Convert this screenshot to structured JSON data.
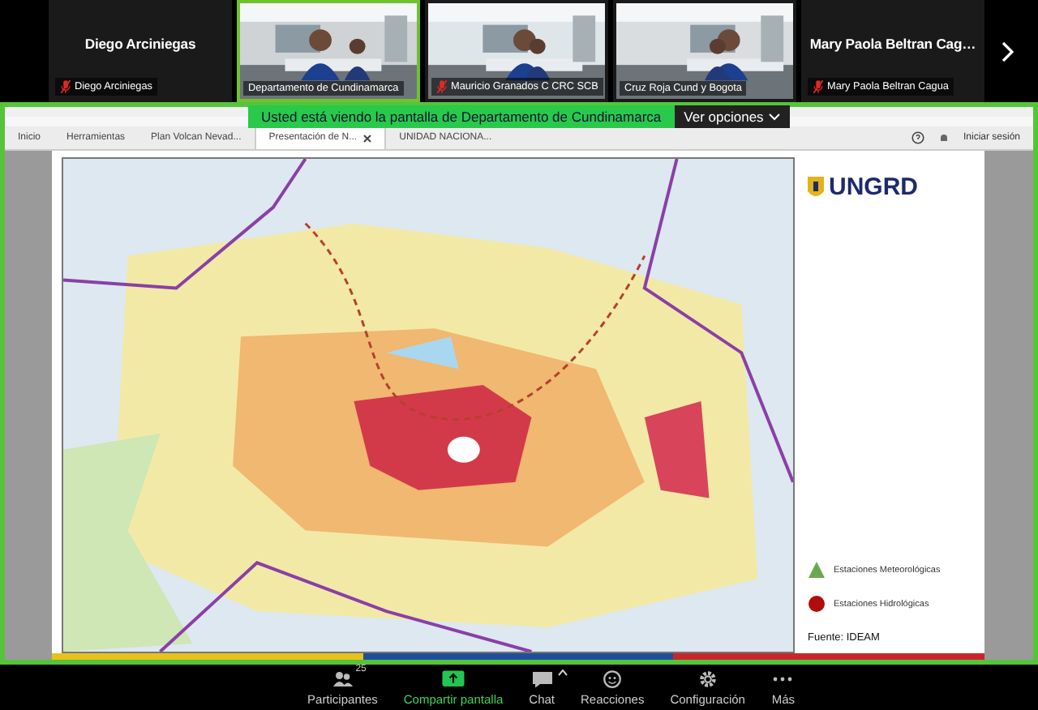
{
  "participants": [
    {
      "kind": "name",
      "display_name": "Diego Arciniegas",
      "label": "Diego Arciniegas",
      "muted": true,
      "speaking": false
    },
    {
      "kind": "video",
      "label": "Departamento de Cundinamarca",
      "muted": false,
      "speaking": true
    },
    {
      "kind": "video",
      "label": "Mauricio Granados C CRC SCB",
      "muted": true,
      "speaking": false
    },
    {
      "kind": "video",
      "label": "Cruz Roja Cund y Bogota",
      "muted": false,
      "speaking": false
    },
    {
      "kind": "name",
      "display_name": "Mary Paola Beltran Cag…",
      "label": "Mary Paola Beltran Cagua",
      "muted": true,
      "speaking": false
    }
  ],
  "shared_screen": {
    "banner": "Usted está viendo la pantalla de Departamento de Cundinamarca",
    "options_button": "Ver opciones",
    "tabs": [
      {
        "label": "Inicio",
        "selected": false
      },
      {
        "label": "Herramientas",
        "selected": false
      },
      {
        "label": "Plan Volcan Nevad...",
        "selected": false
      },
      {
        "label": "Presentación de N...",
        "selected": true
      },
      {
        "label": "UNIDAD NACIONA...",
        "selected": false
      }
    ],
    "sign_in": "Iniciar sesión",
    "slide": {
      "logo": "UNGRD",
      "legend": [
        {
          "kind": "triangle",
          "color": "#6aa84f",
          "label": "Estaciones Meteorológicas"
        },
        {
          "kind": "circle",
          "color": "#b00d0d",
          "label": "Estaciones Hidrológicas"
        }
      ],
      "source": "Fuente: IDEAM"
    }
  },
  "toolbar": [
    {
      "kind": "participants",
      "label": "Participantes",
      "badge": "25",
      "active": false,
      "menu": false
    },
    {
      "kind": "share",
      "label": "Compartir pantalla",
      "active": true,
      "menu": false
    },
    {
      "kind": "chat",
      "label": "Chat",
      "active": false,
      "menu": true
    },
    {
      "kind": "reactions",
      "label": "Reacciones",
      "active": false,
      "menu": false
    },
    {
      "kind": "settings",
      "label": "Configuración",
      "active": false,
      "menu": false
    },
    {
      "kind": "more",
      "label": "Más",
      "active": false,
      "menu": false
    }
  ]
}
